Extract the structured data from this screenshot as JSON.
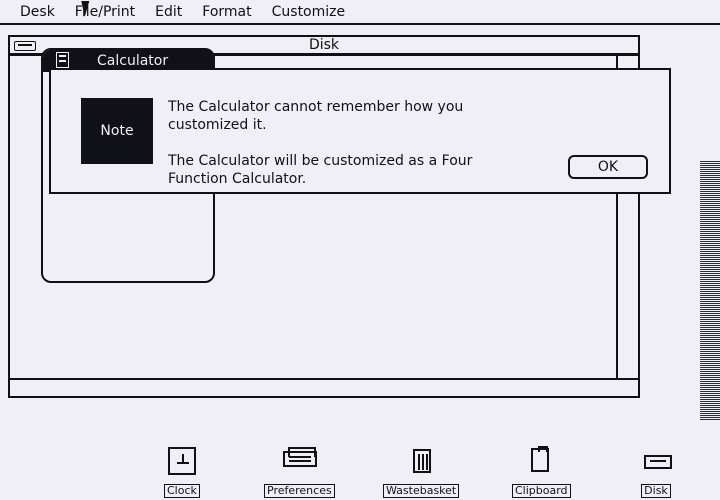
{
  "menu": {
    "items": [
      "Desk",
      "File/Print",
      "Edit",
      "Format",
      "Customize"
    ]
  },
  "windows": {
    "disk_title": "Disk",
    "calculator_title": "Calculator"
  },
  "dialog": {
    "badge": "Note",
    "line1": "The Calculator cannot remember how you customized it.",
    "line2": "The Calculator will be customized as a Four Function Calculator.",
    "ok_label": "OK"
  },
  "dock": {
    "items": [
      {
        "label": "Clock",
        "icon": "clock-icon"
      },
      {
        "label": "Preferences",
        "icon": "preferences-icon"
      },
      {
        "label": "Wastebasket",
        "icon": "wastebasket-icon"
      },
      {
        "label": "Clipboard",
        "icon": "clipboard-icon"
      },
      {
        "label": "Disk",
        "icon": "disk-icon"
      }
    ]
  }
}
